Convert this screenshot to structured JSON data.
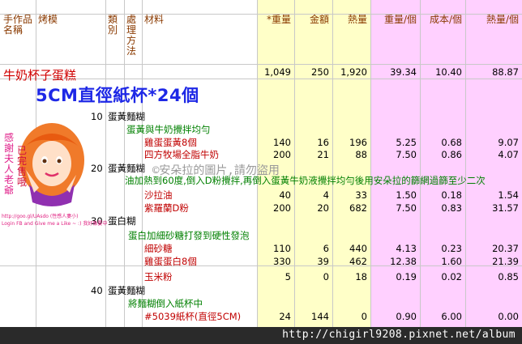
{
  "headers": {
    "name": "手作品名稱",
    "mold": "烤模",
    "category": "類別",
    "method": "處理方法",
    "material": "材料",
    "weight": "*重量",
    "amount": "金額",
    "calories": "熱量",
    "weight_each": "重量/個",
    "cost_each": "成本/個",
    "calories_each": "熱量/個"
  },
  "product": {
    "name": "牛奶杯子蛋糕",
    "mold_desc": "5CM直徑紙杯*24個",
    "totals": {
      "weight": "1,049",
      "amount": "250",
      "calories": "1,920",
      "weight_each": "39.34",
      "cost_each": "10.40",
      "calories_each": "88.87"
    }
  },
  "rows": [
    {
      "kind": "step",
      "code": "10",
      "text": "蛋黃麵糊"
    },
    {
      "kind": "sub",
      "text": "蛋黃與牛奶攪拌均勻"
    },
    {
      "kind": "ing",
      "text": "雞蛋蛋黃8個",
      "weight": "140",
      "amount": "16",
      "calories": "196",
      "weight_each": "5.25",
      "cost_each": "0.68",
      "calories_each": "9.07"
    },
    {
      "kind": "ing",
      "text": "四方牧場全脂牛奶",
      "weight": "200",
      "amount": "21",
      "calories": "88",
      "weight_each": "7.50",
      "cost_each": "0.86",
      "calories_each": "4.07"
    },
    {
      "kind": "step",
      "code": "20",
      "text": "蛋黃麵糊"
    },
    {
      "kind": "sub",
      "text": "油加熱到60度,倒入D粉攪拌,再倒入蛋黃牛奶液攪拌均勻後用安朵拉的篩網過篩至少二次"
    },
    {
      "kind": "ing",
      "text": "沙拉油",
      "weight": "40",
      "amount": "4",
      "calories": "33",
      "weight_each": "1.50",
      "cost_each": "0.18",
      "calories_each": "1.54"
    },
    {
      "kind": "ing",
      "text": "紫羅蘭D粉",
      "weight": "200",
      "amount": "20",
      "calories": "682",
      "weight_each": "7.50",
      "cost_each": "0.83",
      "calories_each": "31.57"
    },
    {
      "kind": "step",
      "code": "30",
      "text": "蛋白糊"
    },
    {
      "kind": "sub",
      "text": "蛋白加細砂糖打發到硬性發泡"
    },
    {
      "kind": "ing",
      "text": "細砂糖",
      "weight": "110",
      "amount": "6",
      "calories": "440",
      "weight_each": "4.13",
      "cost_each": "0.23",
      "calories_each": "20.37"
    },
    {
      "kind": "ing",
      "text": "雞蛋蛋白8個",
      "weight": "330",
      "amount": "39",
      "calories": "462",
      "weight_each": "12.38",
      "cost_each": "1.60",
      "calories_each": "21.39"
    },
    {
      "kind": "ing",
      "text": "玉米粉",
      "weight": "5",
      "amount": "0",
      "calories": "18",
      "weight_each": "0.19",
      "cost_each": "0.02",
      "calories_each": "0.85"
    },
    {
      "kind": "step",
      "code": "40",
      "text": "蛋黃麵糊"
    },
    {
      "kind": "sub",
      "text": "將麵糊倒入紙杯中"
    },
    {
      "kind": "ing",
      "text": "#5039紙杯(直徑5CM)",
      "weight": "24",
      "amount": "144",
      "calories": "0",
      "weight_each": "0.90",
      "cost_each": "6.00",
      "calories_each": "0.00"
    }
  ],
  "sticker": {
    "left_text": "感謝夫人老爺",
    "right_text": "已完售哦",
    "caption": "http://goo.gl/UAsdo (性感人妻小)",
    "caption2": "Login FB and Give me a Like ~ :) 我好像要中"
  },
  "watermark": "©安朵拉的圖片,請勿盜用",
  "footer_url": "http://chigirl9208.pixnet.net/album"
}
